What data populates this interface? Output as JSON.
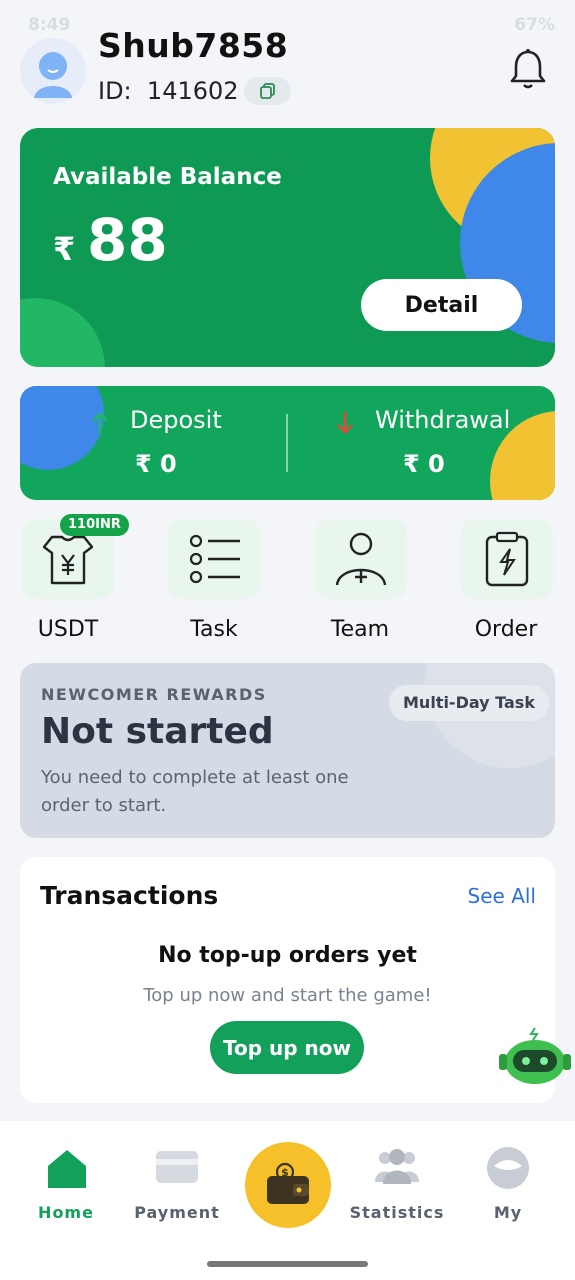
{
  "status_bar": {
    "time": "8:49",
    "battery": "67%"
  },
  "profile": {
    "username": "Shub7858",
    "id_label": "ID:",
    "id_value": "141602"
  },
  "balance": {
    "label": "Available Balance",
    "currency": "₹",
    "amount": "88",
    "detail_label": "Detail"
  },
  "flows": {
    "deposit": {
      "label": "Deposit",
      "amount": "₹ 0"
    },
    "withdrawal": {
      "label": "Withdrawal",
      "amount": "₹ 0"
    }
  },
  "quick_actions": [
    {
      "label": "USDT",
      "icon": "usdt-shirt-icon",
      "badge": "110INR"
    },
    {
      "label": "Task",
      "icon": "task-list-icon"
    },
    {
      "label": "Team",
      "icon": "team-add-user-icon"
    },
    {
      "label": "Order",
      "icon": "order-clipboard-icon"
    }
  ],
  "rewards": {
    "kicker": "NEWCOMER REWARDS",
    "status": "Not started",
    "description": "You need to complete at least one order to start.",
    "tag": "Multi-Day Task"
  },
  "transactions": {
    "title": "Transactions",
    "see_all": "See All",
    "empty_title": "No top-up orders yet",
    "empty_desc": "Top up now and start the game!",
    "cta": "Top up now"
  },
  "nav": {
    "items": [
      {
        "label": "Home",
        "icon": "home-icon",
        "active": true
      },
      {
        "label": "Payment",
        "icon": "card-icon"
      },
      {
        "label": "",
        "icon": "wallet-icon"
      },
      {
        "label": "Statistics",
        "icon": "users-icon"
      },
      {
        "label": "My",
        "icon": "profile-icon"
      }
    ]
  },
  "colors": {
    "primary_green": "#0e9a54",
    "accent_yellow": "#f5c02a",
    "accent_blue": "#3f87e8",
    "link_blue": "#2f6fd9"
  }
}
